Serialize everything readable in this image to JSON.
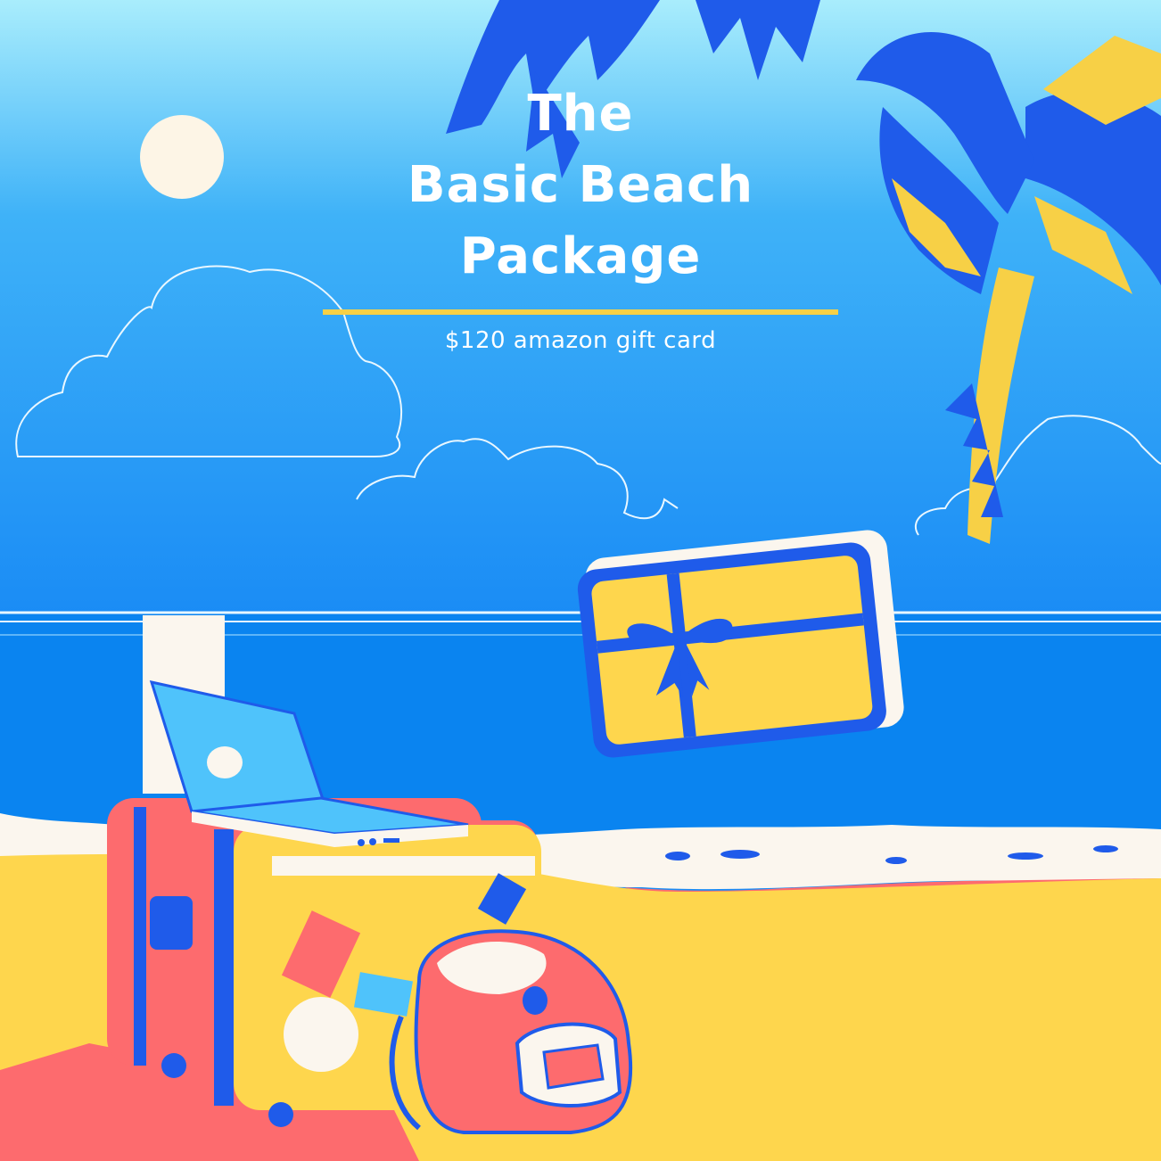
{
  "title": {
    "line1": "The",
    "line2": "Basic Beach",
    "line3": "Package"
  },
  "subtitle": "$120 amazon gift card",
  "colors": {
    "sky_top": "#a8ecfb",
    "sky_bottom": "#1a8cf5",
    "sea": "#0a84f0",
    "sand": "#fed64d",
    "coral": "#fd6b6e",
    "royal_blue": "#1f5bea",
    "cream": "#fbf6ee",
    "accent_yellow": "#f7d046"
  }
}
